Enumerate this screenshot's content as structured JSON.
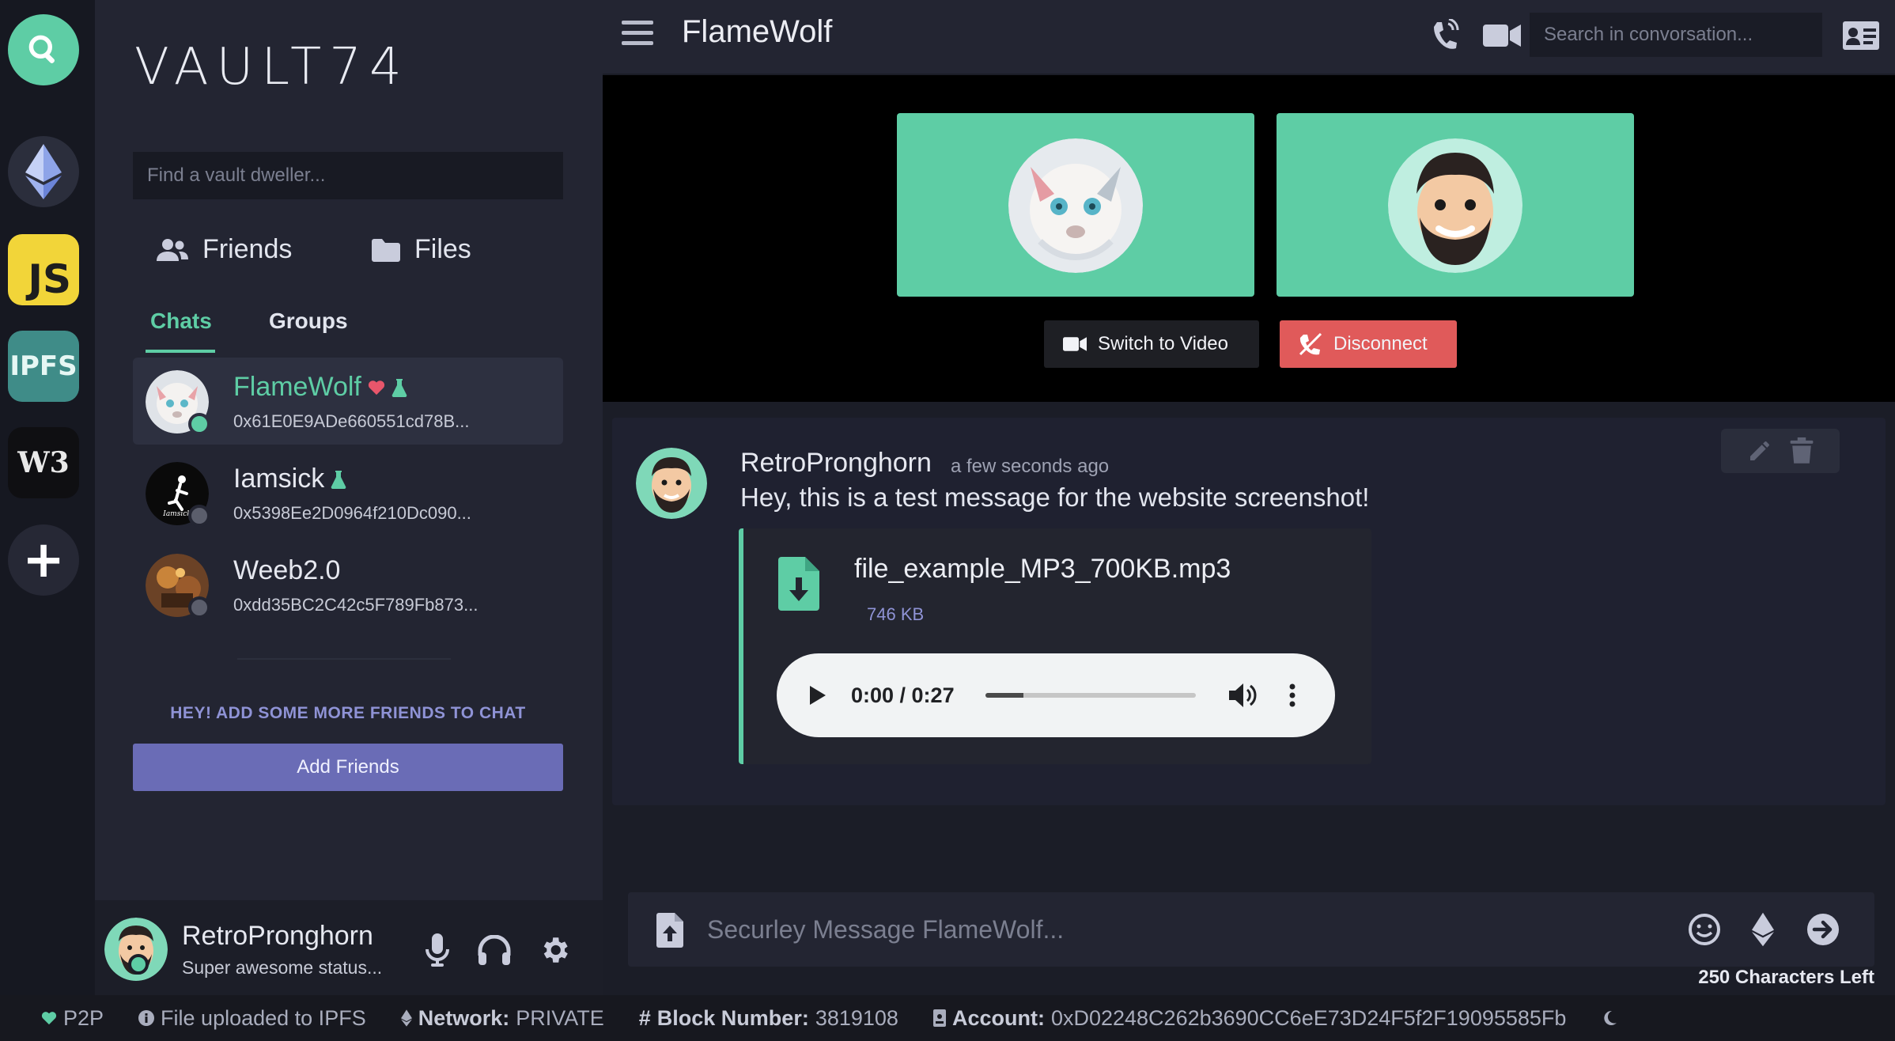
{
  "app": {
    "brand": "VAULT74"
  },
  "sidebar": {
    "search_placeholder": "Find a vault dweller...",
    "nav": {
      "friends": "Friends",
      "files": "Files"
    },
    "tabs": {
      "chats": "Chats",
      "groups": "Groups"
    },
    "chats": [
      {
        "name": "FlameWolf",
        "address": "0x61E0E9ADe660551cd78B...",
        "status": "online",
        "selected": true
      },
      {
        "name": "Iamsick",
        "address": "0x5398Ee2D0964f210Dc090...",
        "status": "offline",
        "selected": false
      },
      {
        "name": "Weeb2.0",
        "address": "0xdd35BC2C42c5F789Fb873...",
        "status": "offline",
        "selected": false
      }
    ],
    "add_hint": "HEY! ADD SOME MORE FRIENDS TO CHAT",
    "add_button": "Add Friends"
  },
  "user": {
    "name": "RetroPronghorn",
    "status": "Super awesome status..."
  },
  "conversation": {
    "title": "FlameWolf",
    "search_placeholder": "Search in convorsation...",
    "call": {
      "switch_video": "Switch to Video",
      "disconnect": "Disconnect"
    },
    "message": {
      "author": "RetroPronghorn",
      "time": "a few seconds ago",
      "text": "Hey, this is a test message for the website screenshot!",
      "file": {
        "name": "file_example_MP3_700KB.mp3",
        "size": "746 KB"
      },
      "audio": {
        "time": "0:00 / 0:27",
        "progress": 0.18
      }
    },
    "composer": {
      "placeholder": "Securley Message FlameWolf...",
      "chars_left": "250 Characters Left"
    }
  },
  "footer": {
    "p2p": "P2P",
    "upload": "File uploaded to IPFS",
    "network_label": "Network:",
    "network_value": "PRIVATE",
    "block_label": "Block Number:",
    "block_value": "3819108",
    "account_label": "Account:",
    "account_value": "0xD02248C262b3690CC6eE73D24F5f2F19095585Fb"
  },
  "colors": {
    "accent": "#5ecda5",
    "danger": "#e05a5a",
    "purple": "#6a6cb6",
    "online": "#5ecda5",
    "offline": "#5b5e6c"
  }
}
